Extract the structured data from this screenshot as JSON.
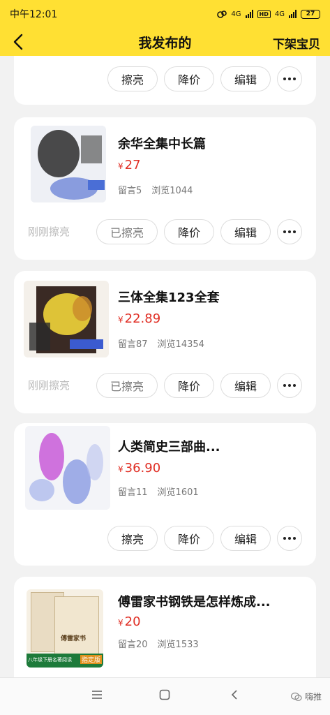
{
  "status": {
    "time": "中午12:01",
    "net1": "4G",
    "hd": "HD",
    "net2": "4G",
    "battery": "27"
  },
  "header": {
    "title": "我发布的",
    "action": "下架宝贝"
  },
  "cards": [
    {
      "actions": {
        "polish": "擦亮",
        "reduce": "降价",
        "edit": "编辑"
      }
    },
    {
      "title": "余华全集中长篇",
      "currency": "¥",
      "price": "27",
      "comments": "留言5",
      "views": "浏览1044",
      "note": "刚刚擦亮",
      "actions": {
        "polish": "已擦亮",
        "reduce": "降价",
        "edit": "编辑"
      }
    },
    {
      "title": "三体全集123全套",
      "currency": "¥",
      "price": "22.89",
      "comments": "留言87",
      "views": "浏览14354",
      "note": "刚刚擦亮",
      "actions": {
        "polish": "已擦亮",
        "reduce": "降价",
        "edit": "编辑"
      }
    },
    {
      "title": "人类简史三部曲...",
      "currency": "¥",
      "price": "36.90",
      "comments": "留言11",
      "views": "浏览1601",
      "actions": {
        "polish": "擦亮",
        "reduce": "降价",
        "edit": "编辑"
      }
    },
    {
      "title": "傅雷家书钢铁是怎样炼成...",
      "currency": "¥",
      "price": "20",
      "comments": "留言20",
      "views": "浏览1533",
      "thumb_labels": {
        "book": "傅雷家书",
        "grade": "八年级下册名著阅读",
        "badge": "指定版"
      }
    }
  ],
  "footer": {
    "watermark": "嗨推"
  }
}
